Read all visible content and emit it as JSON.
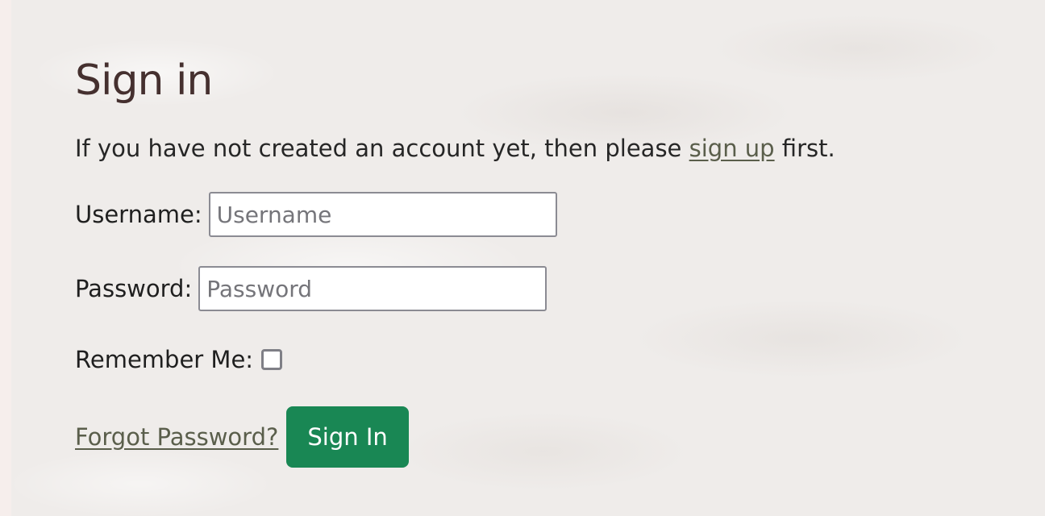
{
  "heading": "Sign in",
  "intro": {
    "before": "If you have not created an account yet, then please ",
    "link": "sign up",
    "after": " first."
  },
  "username": {
    "label": "Username:",
    "placeholder": "Username",
    "value": ""
  },
  "password": {
    "label": "Password:",
    "placeholder": "Password",
    "value": ""
  },
  "remember": {
    "label": "Remember Me:",
    "checked": false
  },
  "forgot_link": "Forgot Password?",
  "submit_label": "Sign In",
  "colors": {
    "heading": "#45302f",
    "link": "#5a5e4b",
    "button": "#198754",
    "background": "#efecea"
  }
}
